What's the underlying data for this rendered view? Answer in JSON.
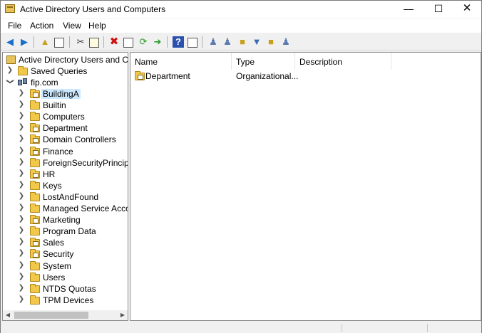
{
  "window": {
    "title": "Active Directory Users and Computers"
  },
  "menu": [
    "File",
    "Action",
    "View",
    "Help"
  ],
  "toolbar": {
    "icons": [
      "back-icon",
      "forward-icon",
      "up-folder-icon",
      "show-console-tree-icon",
      "cut-icon",
      "copy-icon",
      "delete-icon",
      "properties-icon",
      "refresh-icon",
      "export-list-icon",
      "help-icon",
      "action-pane-icon",
      "new-user-icon",
      "new-group-icon",
      "new-ou-icon",
      "filter-icon",
      "find-icon",
      "add-to-group-icon"
    ]
  },
  "tree": {
    "root": "Active Directory Users and Computers",
    "saved_queries": "Saved Queries",
    "domain": "fip.com",
    "children": [
      {
        "label": "BuildingA",
        "ou": true
      },
      {
        "label": "Builtin",
        "ou": false
      },
      {
        "label": "Computers",
        "ou": false
      },
      {
        "label": "Department",
        "ou": true
      },
      {
        "label": "Domain Controllers",
        "ou": true
      },
      {
        "label": "Finance",
        "ou": true
      },
      {
        "label": "ForeignSecurityPrincipals",
        "ou": false
      },
      {
        "label": "HR",
        "ou": true
      },
      {
        "label": "Keys",
        "ou": false
      },
      {
        "label": "LostAndFound",
        "ou": false
      },
      {
        "label": "Managed Service Accounts",
        "ou": false
      },
      {
        "label": "Marketing",
        "ou": true
      },
      {
        "label": "Program Data",
        "ou": false
      },
      {
        "label": "Sales",
        "ou": true
      },
      {
        "label": "Security",
        "ou": true
      },
      {
        "label": "System",
        "ou": false
      },
      {
        "label": "Users",
        "ou": false
      },
      {
        "label": "NTDS Quotas",
        "ou": false
      },
      {
        "label": "TPM Devices",
        "ou": false
      }
    ],
    "selected": "BuildingA"
  },
  "list": {
    "columns": [
      "Name",
      "Type",
      "Description"
    ],
    "rows": [
      {
        "name": "Department",
        "type": "Organizational...",
        "description": ""
      }
    ]
  }
}
